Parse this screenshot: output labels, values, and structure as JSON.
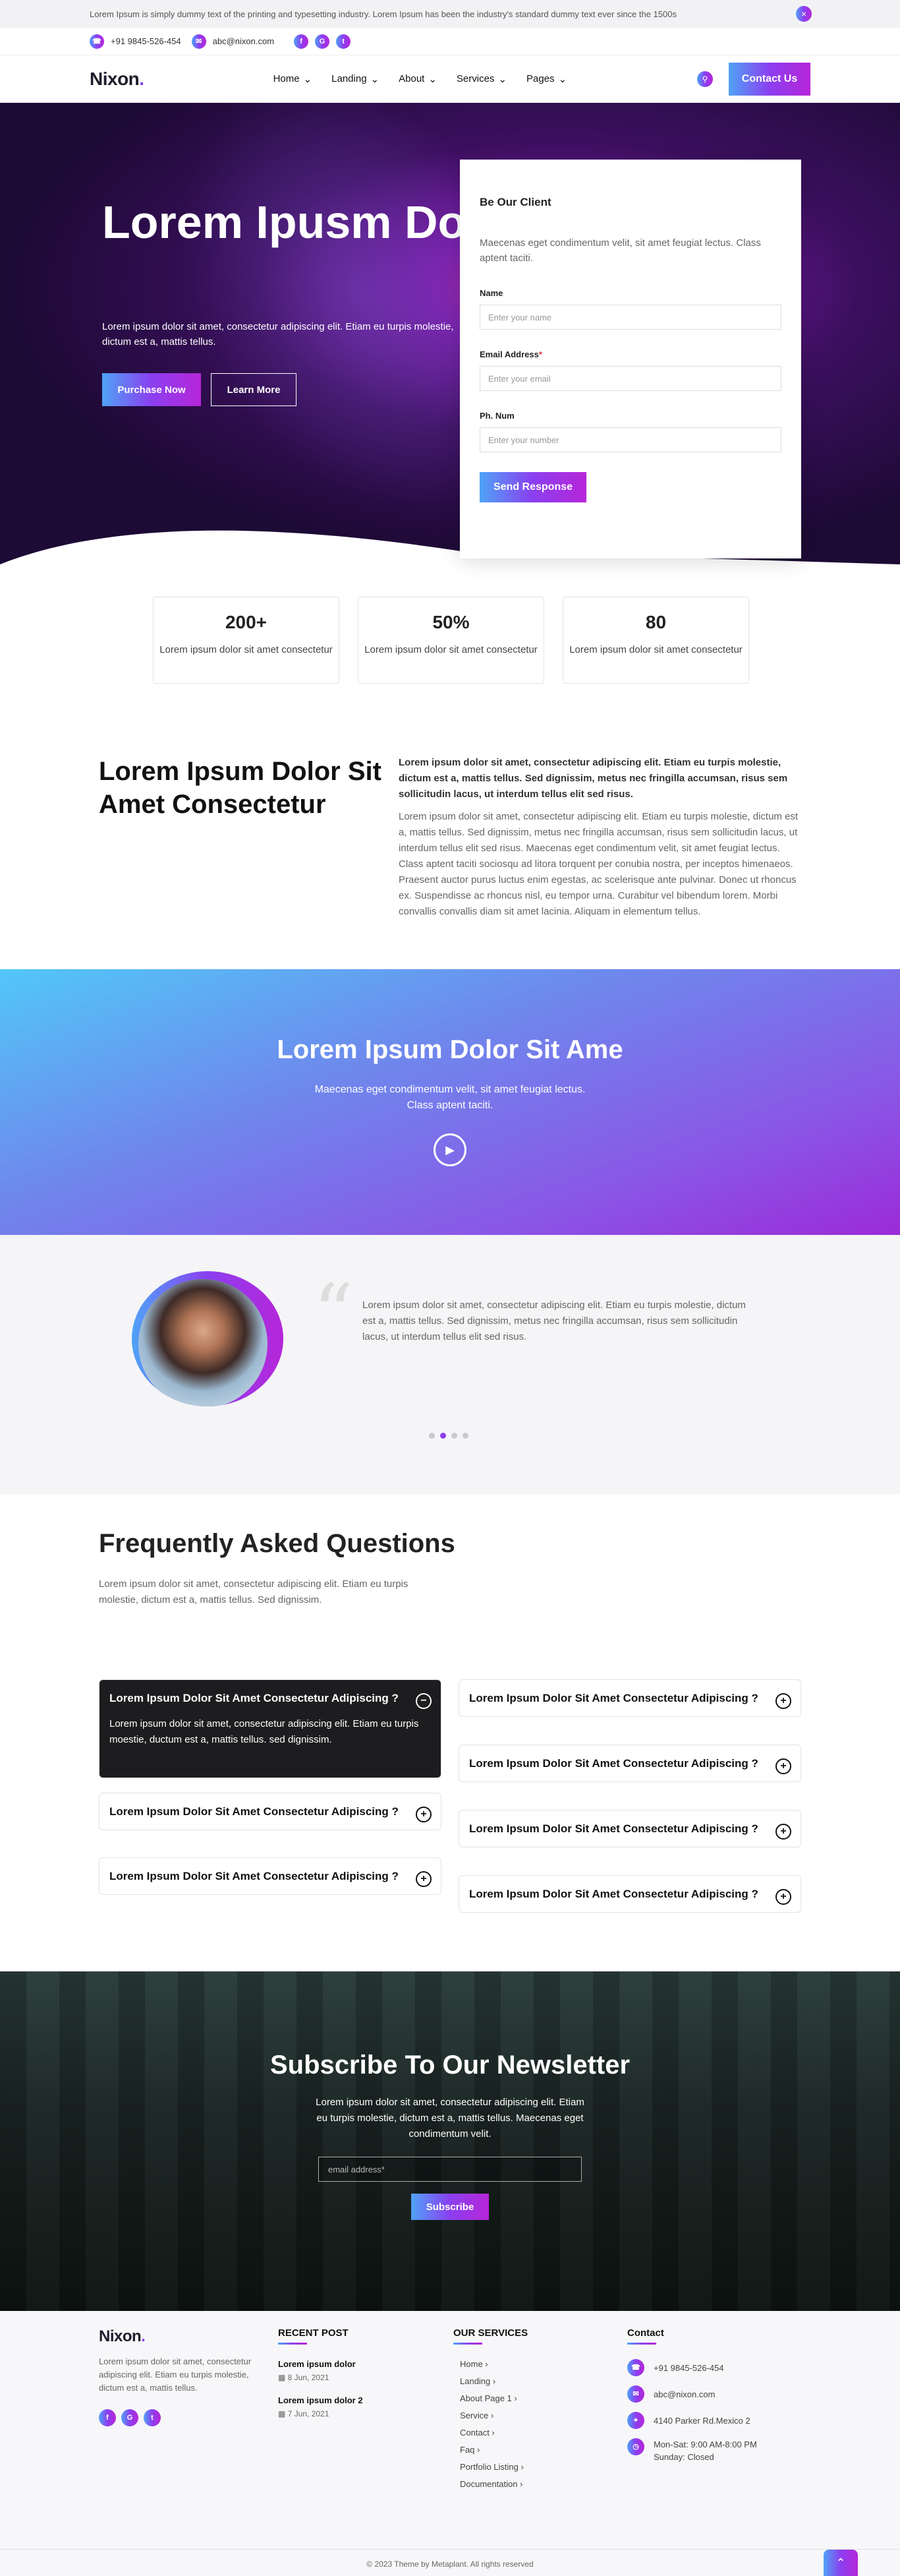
{
  "topbar": {
    "notice": "Lorem Ipsum is simply dummy text of the printing and typesetting industry. Lorem Ipsum has been the industry's standard dummy text ever since the 1500s",
    "close": "×"
  },
  "contactbar": {
    "phone": "+91 9845-526-454",
    "email": "abc@nixon.com",
    "social": [
      "f",
      "G",
      "t"
    ]
  },
  "brand": {
    "name": "Nixon",
    "dot": "."
  },
  "nav": {
    "items": [
      "Home",
      "Landing",
      "About",
      "Services",
      "Pages"
    ],
    "cta": "Contact Us"
  },
  "hero": {
    "title": "Lorem Ipusm Dolor Amet",
    "text": "Lorem ipsum dolor sit amet, consectetur adipiscing elit. Etiam eu turpis molestie, dictum est a, mattis tellus.",
    "primary": "Purchase Now",
    "secondary": "Learn More"
  },
  "form": {
    "title": "Be Our Client",
    "desc": "Maecenas eget condimentum velit, sit amet feugiat lectus. Class aptent taciti.",
    "name_label": "Name",
    "name_ph": "Enter your name",
    "email_label": "Email Address",
    "required": "*",
    "email_ph": "Enter your email",
    "phone_label": "Ph. Num",
    "phone_ph": "Enter your number",
    "submit": "Send Response"
  },
  "stats": [
    {
      "num": "200+",
      "text": "Lorem ipsum dolor sit amet consectetur"
    },
    {
      "num": "50%",
      "text": "Lorem ipsum dolor sit amet consectetur"
    },
    {
      "num": "80",
      "text": "Lorem ipsum dolor sit amet consectetur"
    }
  ],
  "about": {
    "title": "Lorem Ipsum Dolor Sit Amet Consectetur",
    "lead": "Lorem ipsum dolor sit amet, consectetur adipiscing elit. Etiam eu turpis molestie, dictum est a, mattis tellus. Sed dignissim, metus nec fringilla accumsan, risus sem sollicitudin lacus, ut interdum tellus elit sed risus.",
    "body": "Lorem ipsum dolor sit amet, consectetur adipiscing elit. Etiam eu turpis molestie, dictum est a, mattis tellus. Sed dignissim, metus nec fringilla accumsan, risus sem sollicitudin lacus, ut interdum tellus elit sed risus. Maecenas eget condimentum velit, sit amet feugiat lectus. Class aptent taciti sociosqu ad litora torquent per conubia nostra, per inceptos himenaeos. Praesent auctor purus luctus enim egestas, ac scelerisque ante pulvinar. Donec ut rhoncus ex. Suspendisse ac rhoncus nisl, eu tempor urna. Curabitur vel bibendum lorem. Morbi convallis convallis diam sit amet lacinia. Aliquam in elementum tellus."
  },
  "video": {
    "title": "Lorem Ipsum Dolor Sit Ame",
    "text": "Maecenas eget condimentum velit, sit amet feugiat lectus. Class aptent taciti."
  },
  "testimonial": {
    "text": "Lorem ipsum dolor sit amet, consectetur adipiscing elit. Etiam eu turpis molestie, dictum est a, mattis tellus. Sed dignissim, metus nec fringilla accumsan, risus sem sollicitudin lacus, ut interdum tellus elit sed risus.",
    "active_slide": 2,
    "slide_count": 4
  },
  "faq": {
    "title": "Frequently Asked Questions",
    "sub": "Lorem ipsum dolor sit amet, consectetur adipiscing elit. Etiam eu turpis molestie, dictum est a, mattis tellus. Sed dignissim.",
    "question": "Lorem Ipsum Dolor Sit Amet Consectetur Adipiscing ?",
    "answer": "Lorem ipsum dolor sit amet, consectetur adipiscing elit. Etiam eu turpis moestie, ductum est a, mattis tellus. sed dignissim."
  },
  "newsletter": {
    "title": "Subscribe To Our Newsletter",
    "text": "Lorem ipsum dolor sit amet, consectetur adipiscing elit. Etiam eu turpis molestie, dictum est a, mattis tellus. Maecenas eget condimentum velit.",
    "placeholder": "email address*",
    "button": "Subscribe"
  },
  "footer": {
    "about": "Lorem ipsum dolor sit amet, consectetur adipiscing elit. Etiam eu turpis molestie, dictum est a, mattis tellus.",
    "recent_title": "RECENT POST",
    "posts": [
      {
        "title": "Lorem ipsum dolor",
        "date": "8 Jun, 2021"
      },
      {
        "title": "Lorem ipsum dolor 2",
        "date": "7 Jun, 2021"
      }
    ],
    "services_title": "OUR SERVICES",
    "services": [
      "Home",
      "Landing",
      "About Page 1",
      "Service",
      "Contact",
      "Faq",
      "Portfolio Listing",
      "Documentation"
    ],
    "contact_title": "Contact",
    "contact": {
      "phone": "+91 9845-526-454",
      "email": "abc@nixon.com",
      "address": "4140 Parker Rd.Mexico 2",
      "hours": "Mon-Sat: 9:00 AM-8:00 PM Sunday: Closed"
    },
    "copyright": "© 2023 Theme by Metaplant. All rights reserved"
  },
  "colors": {
    "accent_start": "#4fa3f7",
    "accent_mid": "#8b3ff0",
    "accent_end": "#b626d8",
    "dark": "#1d1d1f"
  }
}
